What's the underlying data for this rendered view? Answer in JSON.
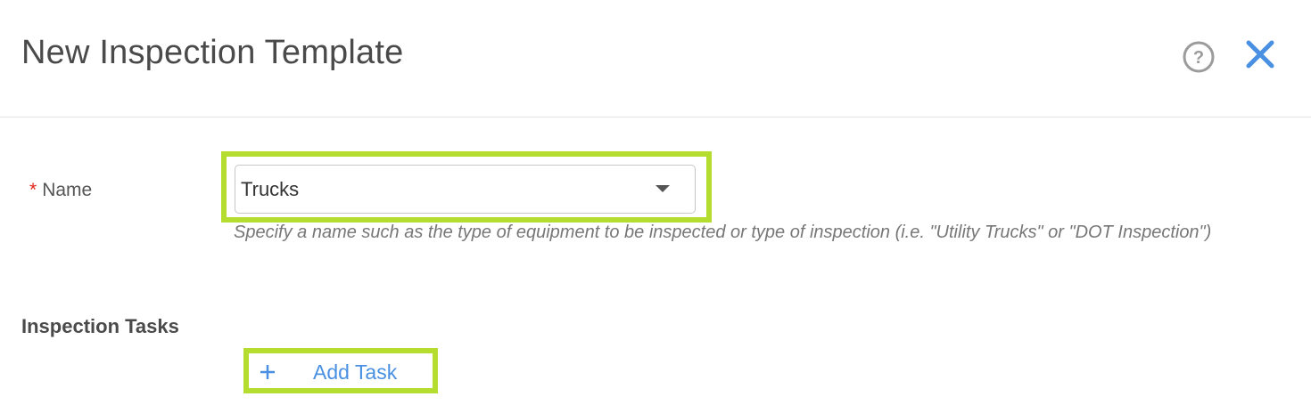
{
  "header": {
    "title": "New Inspection Template"
  },
  "form": {
    "name": {
      "required_marker": "*",
      "label": "Name",
      "value": "Trucks",
      "help_text": "Specify a name such as the type of equipment to be inspected or type of inspection (i.e. \"Utility Trucks\" or \"DOT Inspection\")"
    },
    "tasks": {
      "section_title": "Inspection Tasks",
      "add_label": "Add Task"
    }
  },
  "colors": {
    "accent": "#4a90e2",
    "highlight": "#b5dd30",
    "required": "#e2231a"
  },
  "icons": {
    "help": "help-circle-icon",
    "close": "close-icon",
    "dropdown": "chevron-down-icon",
    "add": "plus-icon"
  }
}
